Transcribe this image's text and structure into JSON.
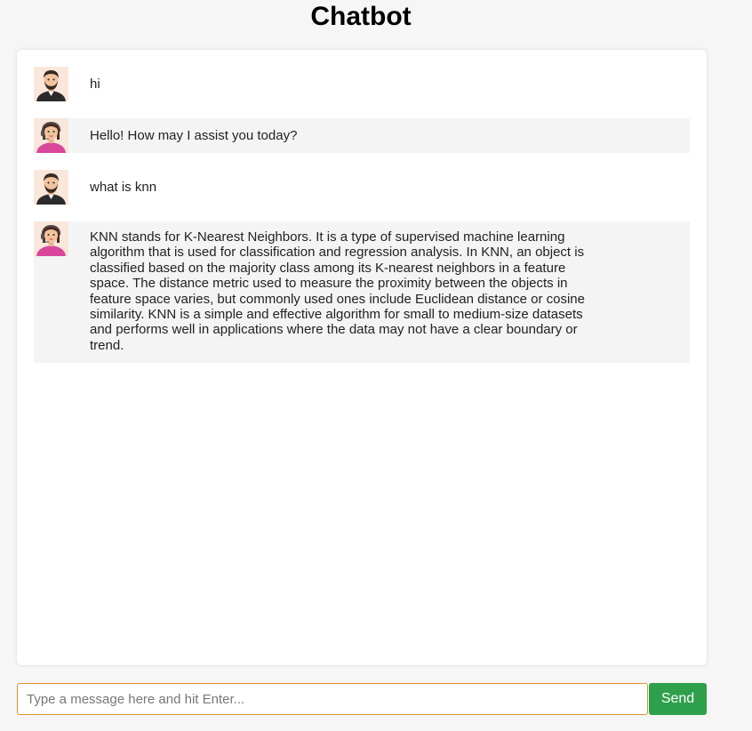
{
  "header": {
    "title": "Chatbot"
  },
  "messages": [
    {
      "role": "user",
      "avatar": "male-user-avatar",
      "text": "hi"
    },
    {
      "role": "bot",
      "avatar": "female-assistant-avatar",
      "text": "Hello! How may I assist you today?"
    },
    {
      "role": "user",
      "avatar": "male-user-avatar",
      "text": "what is knn"
    },
    {
      "role": "bot",
      "avatar": "female-assistant-avatar",
      "text": "KNN stands for K-Nearest Neighbors. It is a type of supervised machine learning algorithm that is used for classification and regression analysis. In KNN, an object is classified based on the majority class among its K-nearest neighbors in a feature space. The distance metric used to measure the proximity between the objects in feature space varies, but commonly used ones include Euclidean distance or cosine similarity. KNN is a simple and effective algorithm for small to medium-size datasets and performs well in applications where the data may not have a clear boundary or trend."
    }
  ],
  "composer": {
    "placeholder": "Type a message here and hit Enter...",
    "value": "",
    "send_label": "Send"
  },
  "colors": {
    "send_button": "#2ea04b",
    "input_focus_border": "#e0922d",
    "bot_bubble": "#f4f4f4"
  }
}
